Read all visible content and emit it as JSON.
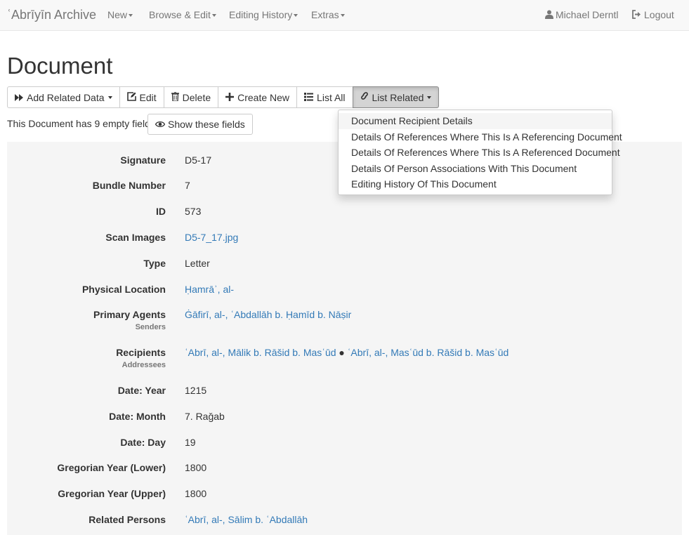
{
  "navbar": {
    "brand": "ʿAbrīyīn Archive",
    "menus": [
      {
        "label": "New"
      },
      {
        "label": "Browse & Edit"
      },
      {
        "label": "Editing History"
      },
      {
        "label": "Extras"
      }
    ],
    "user": "Michael Derntl",
    "logout": "Logout"
  },
  "page": {
    "title": "Document"
  },
  "toolbar": {
    "add_related": "Add Related Data",
    "edit": "Edit",
    "delete": "Delete",
    "create_new": "Create New",
    "list_all": "List All",
    "list_related": "List Related"
  },
  "empty_fields": {
    "text": "This Document has 9 empty fields.",
    "button": "Show these fields"
  },
  "fields": [
    {
      "label": "Signature",
      "value": "D5-17"
    },
    {
      "label": "Bundle Number",
      "value": "7"
    },
    {
      "label": "ID",
      "value": "573"
    },
    {
      "label": "Scan Images",
      "value": "D5-7_17.jpg"
    },
    {
      "label": "Type",
      "value": "Letter"
    },
    {
      "label": "Physical Location",
      "value": "Ḥamrāʾ, al-"
    },
    {
      "label": "Primary Agents",
      "sublabel": "Senders",
      "value": "Ġāfirī, al-, ʿAbdallāh b. Ḥamīd b. Nāṣir"
    },
    {
      "label": "Recipients",
      "sublabel": "Addressees",
      "value1": "ʿAbrī, al-, Mālik b. Rāšid b. Masʿūd",
      "separator": "●",
      "value2": "ʿAbrī, al-, Masʿūd b. Rāšid b. Masʿūd"
    },
    {
      "label": "Date: Year",
      "value": "1215"
    },
    {
      "label": "Date: Month",
      "value": "7. Raǧab"
    },
    {
      "label": "Date: Day",
      "value": "19"
    },
    {
      "label": "Gregorian Year (Lower)",
      "value": "1800"
    },
    {
      "label": "Gregorian Year (Upper)",
      "value": "1800"
    },
    {
      "label": "Related Persons",
      "value": "ʿAbrī, al-, Sālim b. ʿAbdallāh"
    }
  ],
  "dropdown": {
    "items": [
      "Document Recipient Details",
      "Details Of References Where This Is A Referencing Document",
      "Details Of References Where This Is A Referenced Document",
      "Details Of Person Associations With This Document",
      "Editing History Of This Document"
    ]
  }
}
